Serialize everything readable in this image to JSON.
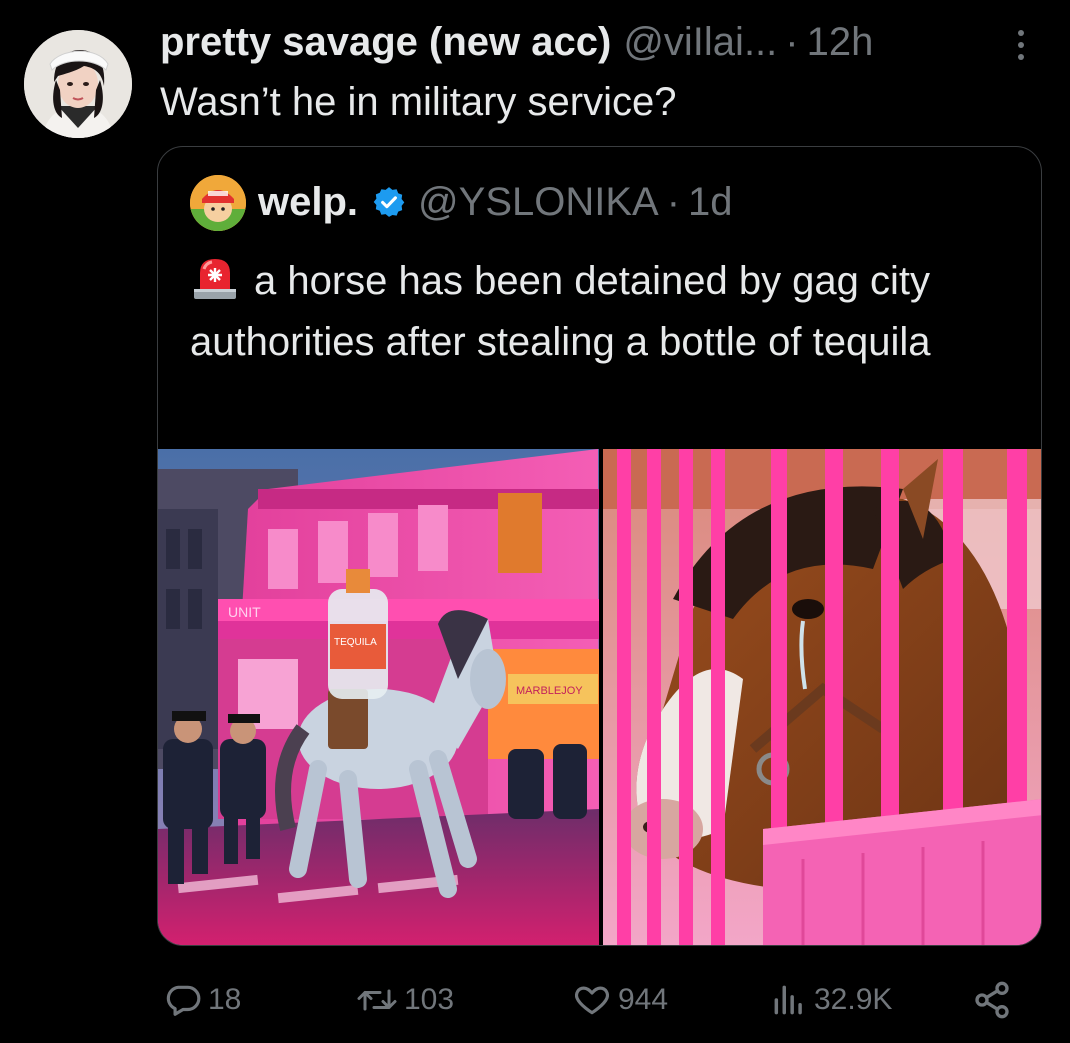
{
  "tweet": {
    "display_name": "pretty savage (new acc)",
    "handle": "@viIlai...",
    "separator": "·",
    "time": "12h",
    "text": "Wasn’t he in military service?",
    "avatar_icon": "user-avatar-photo",
    "more_icon": "more-vertical-icon"
  },
  "quote": {
    "display_name": "welp.",
    "verified_icon": "verified-badge-icon",
    "handle": "@YSLONIKA",
    "separator": "·",
    "time": "1d",
    "emoji": "police-siren-icon",
    "text": "a horse has been detained by gag city authorities after stealing a bottle of tequila",
    "media": [
      {
        "name": "horse-running-with-tequila-image",
        "sign_text": "UNIT",
        "bottle_label": "TEQUILA",
        "shop_sign": "MARBLEJOY"
      },
      {
        "name": "horse-behind-pink-bars-image"
      }
    ]
  },
  "actions": {
    "reply_count": "18",
    "retweet_count": "103",
    "like_count": "944",
    "views_count": "32.9K"
  },
  "colors": {
    "background": "#000000",
    "text_primary": "#e7e9ea",
    "text_secondary": "#71767b",
    "verified_blue": "#1d9bf0",
    "border": "#3a3d40"
  }
}
